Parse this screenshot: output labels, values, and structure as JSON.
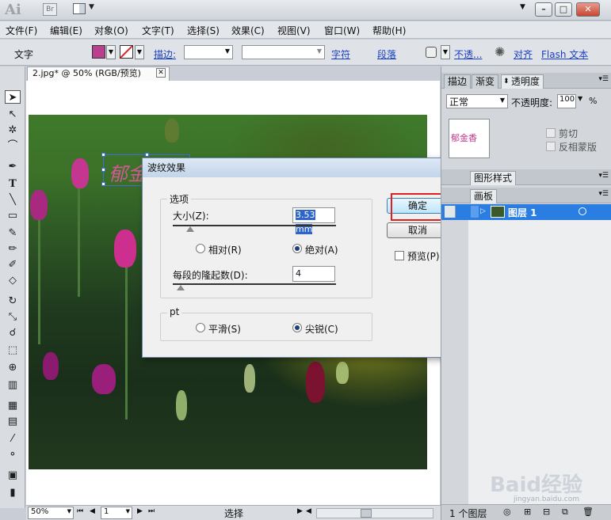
{
  "app": {
    "logo": "Ai",
    "bridge_label": "Br"
  },
  "menu": [
    "文件(F)",
    "编辑(E)",
    "对象(O)",
    "文字(T)",
    "选择(S)",
    "效果(C)",
    "视图(V)",
    "窗口(W)",
    "帮助(H)"
  ],
  "control": {
    "type_label": "文字",
    "stroke_label": "描边:",
    "font_link": "字符",
    "para_link": "段落",
    "opacity_link": "不透...",
    "align_link": "对齐",
    "flash_link": "Flash 文本",
    "fill_color": "#b8408e"
  },
  "document": {
    "tab_title": "2.jpg* @ 50% (RGB/预览)",
    "pink_text": "郁金"
  },
  "status": {
    "zoom": "50%",
    "page": "1",
    "mode": "选择"
  },
  "dialog": {
    "title": "波纹效果",
    "options_group": "选项",
    "size_label": "大小(Z):",
    "size_value": "3.53 mm",
    "relative_label": "相对(R)",
    "absolute_label": "绝对(A)",
    "ridges_label": "每段的隆起数(D):",
    "ridges_value": "4",
    "points_group": "pt",
    "smooth_label": "平滑(S)",
    "corner_label": "尖锐(C)",
    "ok_label": "确定",
    "cancel_label": "取消",
    "preview_label": "预览(P)"
  },
  "panels": {
    "tabs": [
      "描边",
      "渐变",
      "透明度"
    ],
    "blend_mode": "正常",
    "opacity_label": "不透明度:",
    "opacity_value": "100",
    "opacity_unit": "%",
    "thumb_text": "郁金香",
    "clip_label": "剪切",
    "invert_label": "反相蒙版",
    "graphic_styles_tab": "图形样式",
    "artboard_tab": "画板",
    "layer_name": "图层 1",
    "layer_count": "1 个图层"
  },
  "watermark": {
    "text": "Baid经验",
    "url": "jingyan.baidu.com"
  }
}
